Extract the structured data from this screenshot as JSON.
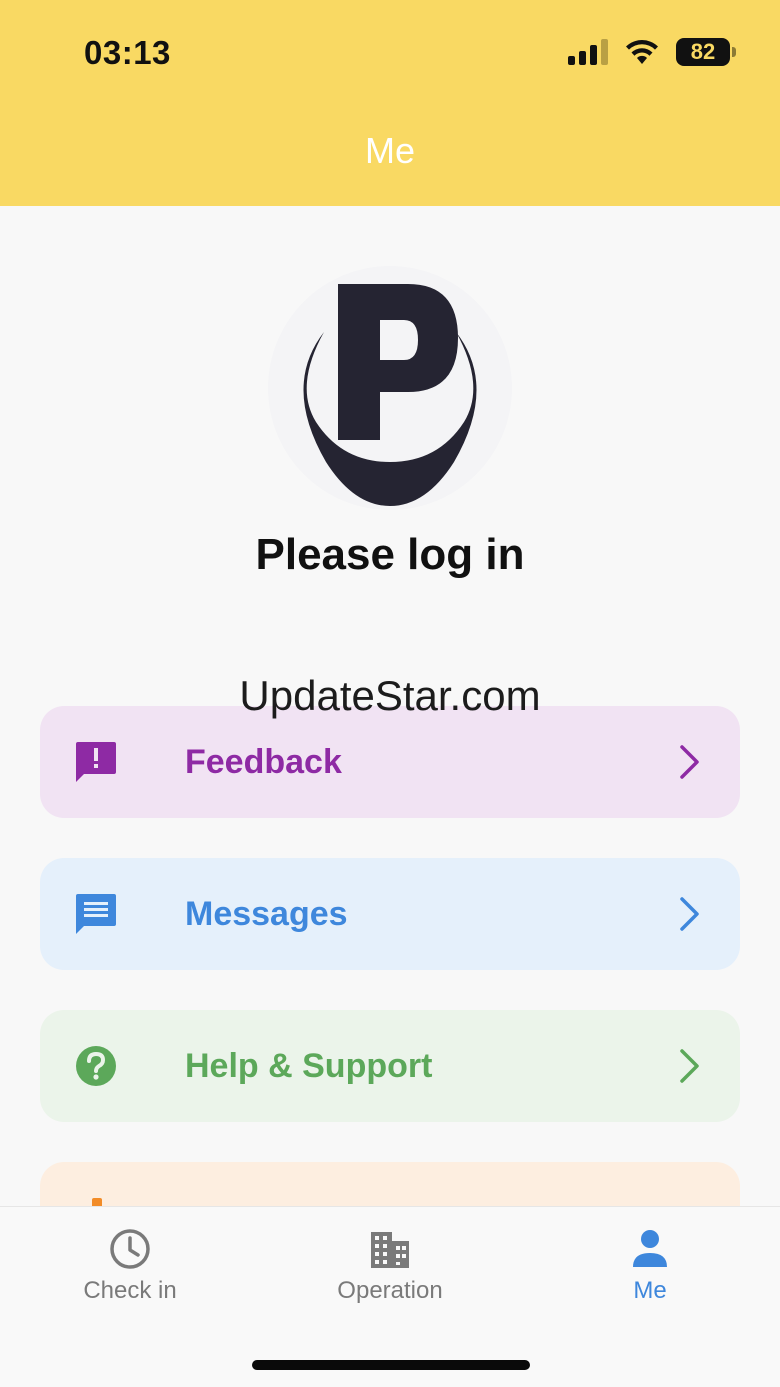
{
  "status_bar": {
    "time": "03:13",
    "battery_level": "82"
  },
  "header": {
    "title": "Me"
  },
  "profile": {
    "prompt": "Please log in"
  },
  "watermark": "UpdateStar.com",
  "menu": [
    {
      "label": "Feedback",
      "icon": "feedback-icon",
      "color": "#8e2aa4"
    },
    {
      "label": "Messages",
      "icon": "message-icon",
      "color": "#3e87dc"
    },
    {
      "label": "Help & Support",
      "icon": "help-icon",
      "color": "#5ca85a"
    }
  ],
  "tabs": [
    {
      "label": "Check in",
      "icon": "clock-icon",
      "active": false
    },
    {
      "label": "Operation",
      "icon": "building-icon",
      "active": false
    },
    {
      "label": "Me",
      "icon": "person-icon",
      "active": true
    }
  ],
  "colors": {
    "header_bg": "#f9d963",
    "accent_blue": "#3e87dc"
  }
}
